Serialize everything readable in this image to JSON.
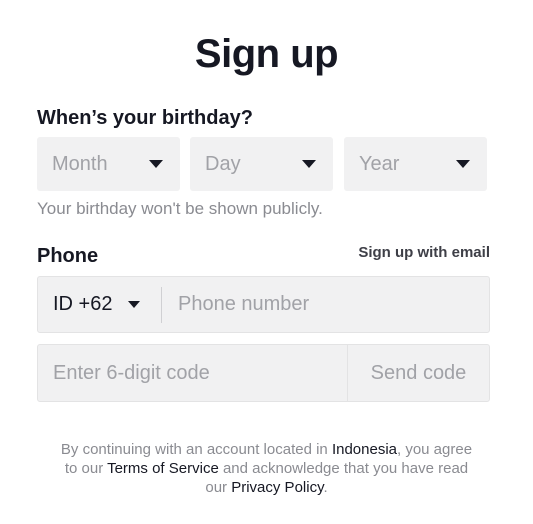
{
  "title": "Sign up",
  "birthday": {
    "label": "When’s your birthday?",
    "month_placeholder": "Month",
    "day_placeholder": "Day",
    "year_placeholder": "Year",
    "hint": "Your birthday won't be shown publicly."
  },
  "phone": {
    "label": "Phone",
    "alt_link": "Sign up with email",
    "country_code": "ID +62",
    "placeholder": "Phone number"
  },
  "code": {
    "placeholder": "Enter 6-digit code",
    "send_label": "Send code"
  },
  "legal": {
    "part1": "By continuing with an account located in ",
    "country": "Indonesia",
    "part2": ", you agree to our ",
    "tos": "Terms of Service",
    "part3": " and acknowledge that you have read our ",
    "privacy": "Privacy Policy",
    "part4": "."
  }
}
